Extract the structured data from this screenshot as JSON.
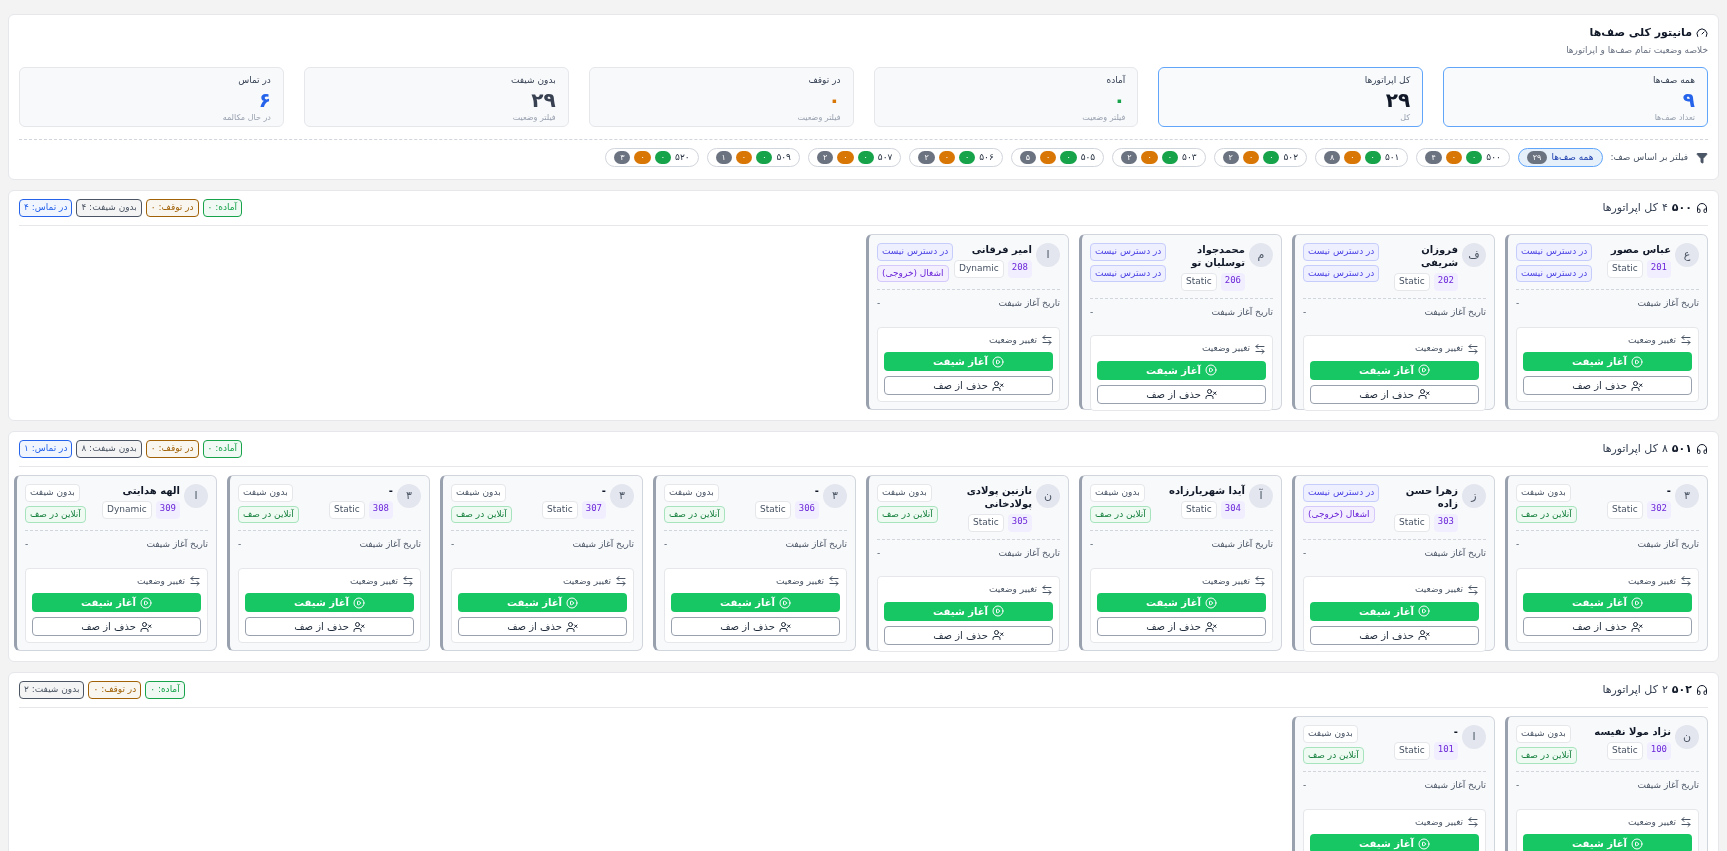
{
  "header": {
    "title": "مانیتور کلی صف‌ها",
    "subtitle": "خلاصه وضعیت تمام صف‌ها و اپراتورها"
  },
  "stats": [
    {
      "label": "همه صف‌ها",
      "value": "۹",
      "caption": "تعداد صف‌ها",
      "selected": true,
      "color": "#2563eb"
    },
    {
      "label": "کل اپراتورها",
      "value": "۲۹",
      "caption": "کل",
      "selected": true,
      "color": "#111827"
    },
    {
      "label": "آماده",
      "value": "۰",
      "caption": "فیلتر وضعیت",
      "selected": false,
      "color": "#16a34a"
    },
    {
      "label": "در توقف",
      "value": "۰",
      "caption": "فیلتر وضعیت",
      "selected": false,
      "color": "#d97706"
    },
    {
      "label": "بدون شیفت",
      "value": "۲۹",
      "caption": "فیلتر وضعیت",
      "selected": false,
      "color": "#374151"
    },
    {
      "label": "در تماس",
      "value": "۶",
      "caption": "در حال مکالمه",
      "selected": false,
      "color": "#2563eb"
    }
  ],
  "filter": {
    "label": "فیلتر بر اساس صف:",
    "chips": [
      {
        "name": "همه صف‌ها",
        "selected": true,
        "counts": [
          {
            "value": "۲۹",
            "color": "#6b7280"
          }
        ]
      },
      {
        "name": "۵۰۰",
        "selected": false,
        "counts": [
          {
            "value": "۰",
            "color": "#16a34a"
          },
          {
            "value": "۰",
            "color": "#d97706"
          },
          {
            "value": "۴",
            "color": "#6b7280"
          }
        ]
      },
      {
        "name": "۵۰۱",
        "selected": false,
        "counts": [
          {
            "value": "۰",
            "color": "#16a34a"
          },
          {
            "value": "۰",
            "color": "#d97706"
          },
          {
            "value": "۸",
            "color": "#6b7280"
          }
        ]
      },
      {
        "name": "۵۰۲",
        "selected": false,
        "counts": [
          {
            "value": "۰",
            "color": "#16a34a"
          },
          {
            "value": "۰",
            "color": "#d97706"
          },
          {
            "value": "۲",
            "color": "#6b7280"
          }
        ]
      },
      {
        "name": "۵۰۳",
        "selected": false,
        "counts": [
          {
            "value": "۰",
            "color": "#16a34a"
          },
          {
            "value": "۰",
            "color": "#d97706"
          },
          {
            "value": "۲",
            "color": "#6b7280"
          }
        ]
      },
      {
        "name": "۵۰۵",
        "selected": false,
        "counts": [
          {
            "value": "۰",
            "color": "#16a34a"
          },
          {
            "value": "۰",
            "color": "#d97706"
          },
          {
            "value": "۵",
            "color": "#6b7280"
          }
        ]
      },
      {
        "name": "۵۰۶",
        "selected": false,
        "counts": [
          {
            "value": "۰",
            "color": "#16a34a"
          },
          {
            "value": "۰",
            "color": "#d97706"
          },
          {
            "value": "۲",
            "color": "#6b7280"
          }
        ]
      },
      {
        "name": "۵۰۷",
        "selected": false,
        "counts": [
          {
            "value": "۰",
            "color": "#16a34a"
          },
          {
            "value": "۰",
            "color": "#d97706"
          },
          {
            "value": "۲",
            "color": "#6b7280"
          }
        ]
      },
      {
        "name": "۵۰۹",
        "selected": false,
        "counts": [
          {
            "value": "۰",
            "color": "#16a34a"
          },
          {
            "value": "۰",
            "color": "#d97706"
          },
          {
            "value": "۱",
            "color": "#6b7280"
          }
        ]
      },
      {
        "name": "۵۲۰",
        "selected": false,
        "counts": [
          {
            "value": "۰",
            "color": "#16a34a"
          },
          {
            "value": "۰",
            "color": "#d97706"
          },
          {
            "value": "۳",
            "color": "#6b7280"
          }
        ]
      }
    ]
  },
  "queues": [
    {
      "name": "۵۰۰",
      "count": "۴",
      "count_label": "کل اپراتورها",
      "badges": [
        {
          "label": "آماده: ۰",
          "color": "#16a34a"
        },
        {
          "label": "در توقف: ۰",
          "color": "#a16207"
        },
        {
          "label": "بدون شیفت: ۴",
          "color": "#4b5563"
        },
        {
          "label": "در تماس: ۴",
          "color": "#2563eb"
        }
      ],
      "operators": [
        {
          "initial": "ع",
          "name": "عباس مصور",
          "ext": "201",
          "type": "Static",
          "tags": [
            {
              "label": "در دسترس نیست",
              "kind": "unavailable"
            },
            {
              "label": "در دسترس نیست",
              "kind": "unavailable"
            }
          ],
          "shift_label": "تاریخ آغاز شیفت",
          "shift_value": "-",
          "actions_title": "تغییر وضعیت",
          "actions": [
            {
              "label": "آغاز شیفت",
              "kind": "start"
            },
            {
              "label": "حذف از صف",
              "kind": "remove"
            }
          ]
        },
        {
          "initial": "ف",
          "name": "فروزان شریفی",
          "ext": "202",
          "type": "Static",
          "tags": [
            {
              "label": "در دسترس نیست",
              "kind": "unavailable"
            },
            {
              "label": "در دسترس نیست",
              "kind": "unavailable"
            }
          ],
          "shift_label": "تاریخ آغاز شیفت",
          "shift_value": "-",
          "actions_title": "تغییر وضعیت",
          "actions": [
            {
              "label": "آغاز شیفت",
              "kind": "start"
            },
            {
              "label": "حذف از صف",
              "kind": "remove"
            }
          ]
        },
        {
          "initial": "م",
          "name": "محمدجواد توسلیان تو",
          "ext": "206",
          "type": "Static",
          "tags": [
            {
              "label": "در دسترس نیست",
              "kind": "unavailable"
            },
            {
              "label": "در دسترس نیست",
              "kind": "unavailable"
            }
          ],
          "shift_label": "تاریخ آغاز شیفت",
          "shift_value": "-",
          "actions_title": "تغییر وضعیت",
          "actions": [
            {
              "label": "آغاز شیفت",
              "kind": "start"
            },
            {
              "label": "حذف از صف",
              "kind": "remove"
            }
          ]
        },
        {
          "initial": "ا",
          "name": "امیر فرقانی",
          "ext": "208",
          "type": "Dynamic",
          "tags": [
            {
              "label": "در دسترس نیست",
              "kind": "unavailable"
            },
            {
              "label": "اشغال (خروجی)",
              "kind": "busy"
            }
          ],
          "shift_label": "تاریخ آغاز شیفت",
          "shift_value": "-",
          "actions_title": "تغییر وضعیت",
          "actions": [
            {
              "label": "آغاز شیفت",
              "kind": "start"
            },
            {
              "label": "حذف از صف",
              "kind": "remove"
            }
          ]
        }
      ]
    },
    {
      "name": "۵۰۱",
      "count": "۸",
      "count_label": "کل اپراتورها",
      "badges": [
        {
          "label": "آماده: ۰",
          "color": "#16a34a"
        },
        {
          "label": "در توقف: ۰",
          "color": "#a16207"
        },
        {
          "label": "بدون شیفت: ۸",
          "color": "#4b5563"
        },
        {
          "label": "در تماس: ۱",
          "color": "#2563eb"
        }
      ],
      "operators": [
        {
          "initial": "۳",
          "name": "-",
          "ext": "302",
          "type": "Static",
          "tags": [
            {
              "label": "بدون شیفت",
              "kind": "no_shift"
            },
            {
              "label": "آنلاین در صف",
              "kind": "online"
            }
          ],
          "shift_label": "تاریخ آغاز شیفت",
          "shift_value": "-",
          "actions_title": "تغییر وضعیت",
          "actions": [
            {
              "label": "آغاز شیفت",
              "kind": "start"
            },
            {
              "label": "حذف از صف",
              "kind": "remove"
            }
          ]
        },
        {
          "initial": "ز",
          "name": "زهرا حسن زاده",
          "ext": "303",
          "type": "Static",
          "tags": [
            {
              "label": "در دسترس نیست",
              "kind": "unavailable"
            },
            {
              "label": "اشغال (خروجی)",
              "kind": "busy"
            }
          ],
          "shift_label": "تاریخ آغاز شیفت",
          "shift_value": "-",
          "actions_title": "تغییر وضعیت",
          "actions": [
            {
              "label": "آغاز شیفت",
              "kind": "start"
            },
            {
              "label": "حذف از صف",
              "kind": "remove"
            }
          ]
        },
        {
          "initial": "آ",
          "name": "آیدا شهریارزاده",
          "ext": "304",
          "type": "Static",
          "tags": [
            {
              "label": "بدون شیفت",
              "kind": "no_shift"
            },
            {
              "label": "آنلاین در صف",
              "kind": "online"
            }
          ],
          "shift_label": "تاریخ آغاز شیفت",
          "shift_value": "-",
          "actions_title": "تغییر وضعیت",
          "actions": [
            {
              "label": "آغاز شیفت",
              "kind": "start"
            },
            {
              "label": "حذف از صف",
              "kind": "remove"
            }
          ]
        },
        {
          "initial": "ن",
          "name": "نازنین پولادی پولادخانی",
          "ext": "305",
          "type": "Static",
          "tags": [
            {
              "label": "بدون شیفت",
              "kind": "no_shift"
            },
            {
              "label": "آنلاین در صف",
              "kind": "online"
            }
          ],
          "shift_label": "تاریخ آغاز شیفت",
          "shift_value": "-",
          "actions_title": "تغییر وضعیت",
          "actions": [
            {
              "label": "آغاز شیفت",
              "kind": "start"
            },
            {
              "label": "حذف از صف",
              "kind": "remove"
            }
          ]
        },
        {
          "initial": "۳",
          "name": "-",
          "ext": "306",
          "type": "Static",
          "tags": [
            {
              "label": "بدون شیفت",
              "kind": "no_shift"
            },
            {
              "label": "آنلاین در صف",
              "kind": "online"
            }
          ],
          "shift_label": "تاریخ آغاز شیفت",
          "shift_value": "-",
          "actions_title": "تغییر وضعیت",
          "actions": [
            {
              "label": "آغاز شیفت",
              "kind": "start"
            },
            {
              "label": "حذف از صف",
              "kind": "remove"
            }
          ]
        },
        {
          "initial": "۳",
          "name": "-",
          "ext": "307",
          "type": "Static",
          "tags": [
            {
              "label": "بدون شیفت",
              "kind": "no_shift"
            },
            {
              "label": "آنلاین در صف",
              "kind": "online"
            }
          ],
          "shift_label": "تاریخ آغاز شیفت",
          "shift_value": "-",
          "actions_title": "تغییر وضعیت",
          "actions": [
            {
              "label": "آغاز شیفت",
              "kind": "start"
            },
            {
              "label": "حذف از صف",
              "kind": "remove"
            }
          ]
        },
        {
          "initial": "۳",
          "name": "-",
          "ext": "308",
          "type": "Static",
          "tags": [
            {
              "label": "بدون شیفت",
              "kind": "no_shift"
            },
            {
              "label": "آنلاین در صف",
              "kind": "online"
            }
          ],
          "shift_label": "تاریخ آغاز شیفت",
          "shift_value": "-",
          "actions_title": "تغییر وضعیت",
          "actions": [
            {
              "label": "آغاز شیفت",
              "kind": "start"
            },
            {
              "label": "حذف از صف",
              "kind": "remove"
            }
          ]
        },
        {
          "initial": "ا",
          "name": "الهه هدایتی",
          "ext": "309",
          "type": "Dynamic",
          "tags": [
            {
              "label": "بدون شیفت",
              "kind": "no_shift"
            },
            {
              "label": "آنلاین در صف",
              "kind": "online"
            }
          ],
          "shift_label": "تاریخ آغاز شیفت",
          "shift_value": "-",
          "actions_title": "تغییر وضعیت",
          "actions": [
            {
              "label": "آغاز شیفت",
              "kind": "start"
            },
            {
              "label": "حذف از صف",
              "kind": "remove"
            }
          ]
        }
      ]
    },
    {
      "name": "۵۰۲",
      "count": "۲",
      "count_label": "کل اپراتورها",
      "badges": [
        {
          "label": "آماده: ۰",
          "color": "#16a34a"
        },
        {
          "label": "در توقف: ۰",
          "color": "#a16207"
        },
        {
          "label": "بدون شیفت: ۲",
          "color": "#4b5563"
        }
      ],
      "operators": [
        {
          "initial": "ن",
          "name": "نژاد مولا نفیسه",
          "ext": "100",
          "type": "Static",
          "tags": [
            {
              "label": "بدون شیفت",
              "kind": "no_shift"
            },
            {
              "label": "آنلاین در صف",
              "kind": "online"
            }
          ],
          "shift_label": "تاریخ آغاز شیفت",
          "shift_value": "-",
          "actions_title": "تغییر وضعیت",
          "actions": [
            {
              "label": "آغاز شیفت",
              "kind": "start"
            }
          ]
        },
        {
          "initial": "ا",
          "name": "-",
          "ext": "101",
          "type": "Static",
          "tags": [
            {
              "label": "بدون شیفت",
              "kind": "no_shift"
            },
            {
              "label": "آنلاین در صف",
              "kind": "online"
            }
          ],
          "shift_label": "تاریخ آغاز شیفت",
          "shift_value": "-",
          "actions_title": "تغییر وضعیت",
          "actions": [
            {
              "label": "آغاز شیفت",
              "kind": "start"
            }
          ]
        }
      ]
    }
  ]
}
